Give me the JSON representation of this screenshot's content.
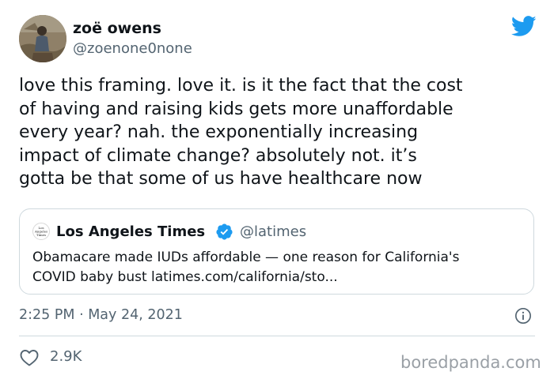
{
  "author": {
    "display_name": "zoë owens",
    "handle": "@zoenone0none",
    "avatar_icon": "user-photo"
  },
  "tweet": {
    "lines": [
      "love this framing. love it. is it the fact that the cost",
      "of having and raising kids gets more unaffordable",
      "every year? nah. the exponentially increasing",
      "impact of climate change? absolutely not. it’s",
      "gotta be that some of us have healthcare now"
    ],
    "timestamp": "2:25 PM · May 24, 2021",
    "likes": "2.9K"
  },
  "quoted_tweet": {
    "display_name": "Los Angeles Times",
    "handle": "@latimes",
    "verified": true,
    "logo_text": [
      "Los",
      "Angeles",
      "Times"
    ],
    "lines": [
      "Obamacare made IUDs affordable — one reason for California's",
      "COVID baby bust latimes.com/california/sto..."
    ]
  },
  "watermark": "boredpanda.com",
  "icons": {
    "brand": "twitter-bird-icon",
    "verified": "verified-badge-icon",
    "info": "info-icon",
    "like": "heart-icon"
  },
  "colors": {
    "twitter_blue": "#1d9bf0",
    "text_primary": "#0f1419",
    "text_secondary": "#536471",
    "border": "#cfd9de",
    "watermark": "#9aa0a6"
  }
}
